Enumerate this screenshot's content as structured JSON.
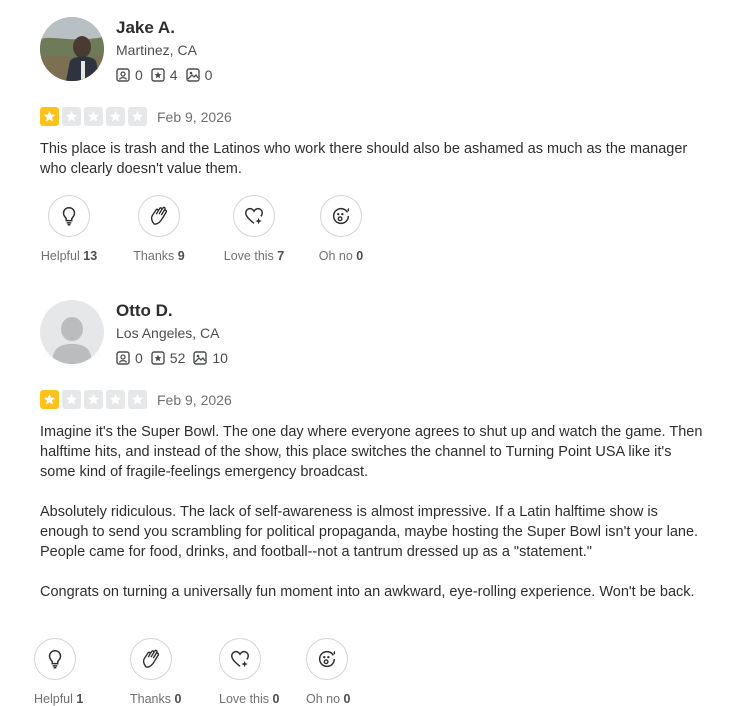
{
  "reviews": [
    {
      "user": {
        "name": "Jake A.",
        "location": "Martinez, CA",
        "friends": "0",
        "reviews": "4",
        "photos": "0"
      },
      "rating": 1,
      "date": "Feb 9, 2026",
      "paragraphs": [
        "This place is trash and the Latinos who work there should also be ashamed as much as the manager who clearly doesn't value them."
      ],
      "reactions": [
        {
          "label": "Helpful",
          "count": "13",
          "icon": "lightbulb-icon"
        },
        {
          "label": "Thanks",
          "count": "9",
          "icon": "clapping-hands-icon"
        },
        {
          "label": "Love this",
          "count": "7",
          "icon": "heart-sparkle-icon"
        },
        {
          "label": "Oh no",
          "count": "0",
          "icon": "shocked-face-icon"
        }
      ]
    },
    {
      "user": {
        "name": "Otto D.",
        "location": "Los Angeles, CA",
        "friends": "0",
        "reviews": "52",
        "photos": "10"
      },
      "rating": 1,
      "date": "Feb 9, 2026",
      "paragraphs": [
        "Imagine it's the Super Bowl. The one day where everyone agrees to shut up and watch the game. Then halftime hits, and instead of the show, this place switches the channel to Turning Point USA like it's some kind of fragile-feelings emergency broadcast.",
        "Absolutely ridiculous. The lack of self-awareness is almost impressive. If a Latin halftime show is enough to send you scrambling for political propaganda, maybe hosting the Super Bowl isn't your lane. People came for food, drinks, and football--not a tantrum dressed up as a \"statement.\"",
        "Congrats on turning a universally fun moment into an awkward, eye-rolling experience. Won't be back."
      ],
      "reactions": [
        {
          "label": "Helpful",
          "count": "1",
          "icon": "lightbulb-icon"
        },
        {
          "label": "Thanks",
          "count": "0",
          "icon": "clapping-hands-icon"
        },
        {
          "label": "Love this",
          "count": "0",
          "icon": "heart-sparkle-icon"
        },
        {
          "label": "Oh no",
          "count": "0",
          "icon": "shocked-face-icon"
        }
      ]
    }
  ],
  "colors": {
    "star_on": "#fcc21b",
    "star_off": "#e6e7e8",
    "text": "#2d2e2f"
  }
}
